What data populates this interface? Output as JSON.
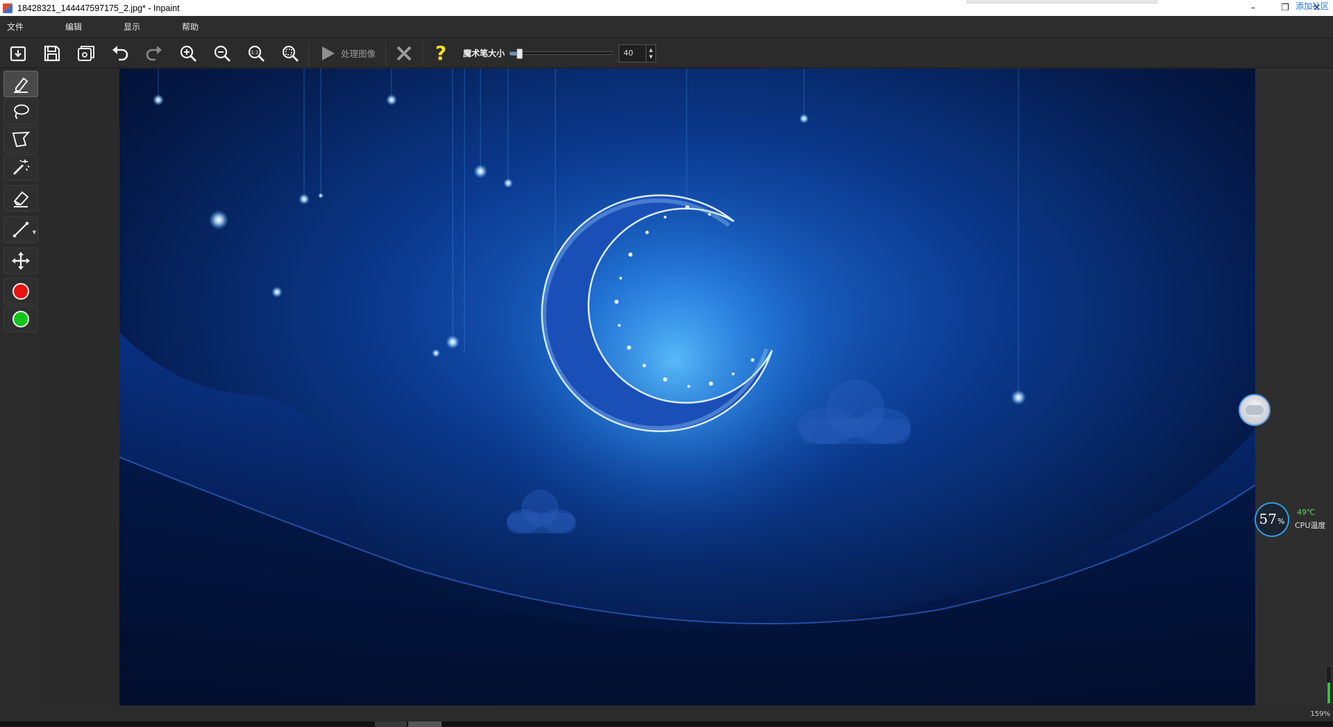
{
  "window": {
    "title": "18428321_144447597175_2.jpg* - Inpaint",
    "minimize_glyph": "–",
    "restore_glyph": "❐",
    "close_glyph": "✕",
    "tray_link": "添加社区"
  },
  "menu": [
    "文件",
    "编辑",
    "显示",
    "帮助"
  ],
  "toolbar": {
    "icons": [
      "open-file-icon",
      "save-icon",
      "batch-icon",
      "undo-icon",
      "redo-icon",
      "zoom-in-icon",
      "zoom-out-icon",
      "zoom-actual-icon",
      "zoom-fit-icon"
    ],
    "process_label": "处理图像",
    "cancel_icon": "cancel-icon",
    "help_glyph": "?",
    "brush_size_label": "魔术笔大小",
    "brush_size_value": "40",
    "brush_size_fraction": 0.08
  },
  "tools": [
    "marker-tool",
    "lasso-tool",
    "polygon-lasso-tool",
    "magic-wand-tool",
    "eraser-tool",
    "guide-line-tool",
    "move-tool"
  ],
  "colors": {
    "red_marker": "#e8130f",
    "green_marker": "#12c51a",
    "accent": "#2ea0e6"
  },
  "status": {
    "cpu_percent": "57",
    "cpu_percent_sign": "%",
    "cpu_temp": "49℃",
    "cpu_label": "CPU温度",
    "zoom": "159%"
  }
}
